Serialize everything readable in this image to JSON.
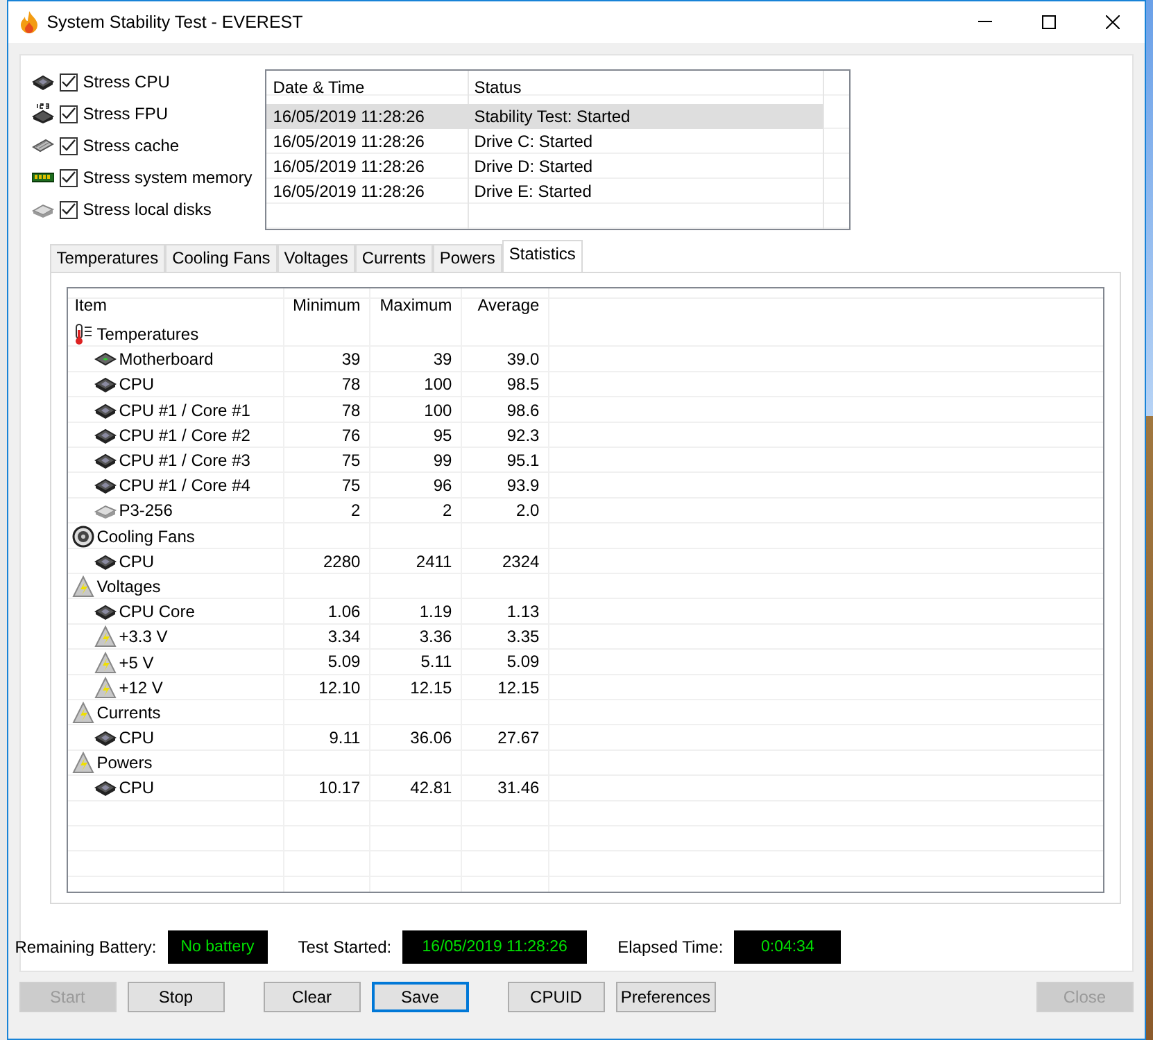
{
  "window": {
    "title": "System Stability Test - EVEREST"
  },
  "stress_options": [
    {
      "label": "Stress CPU",
      "checked": true,
      "kind": "cpu"
    },
    {
      "label": "Stress FPU",
      "checked": true,
      "kind": "fpu"
    },
    {
      "label": "Stress cache",
      "checked": true,
      "kind": "cache"
    },
    {
      "label": "Stress system memory",
      "checked": true,
      "kind": "memory"
    },
    {
      "label": "Stress local disks",
      "checked": true,
      "kind": "disk"
    }
  ],
  "log": {
    "columns": [
      "Date & Time",
      "Status"
    ],
    "rows": [
      {
        "cells": [
          "16/05/2019 11:28:26",
          "Stability Test: Started"
        ],
        "selected": true
      },
      {
        "cells": [
          "16/05/2019 11:28:26",
          "Drive C: Started"
        ],
        "selected": false
      },
      {
        "cells": [
          "16/05/2019 11:28:26",
          "Drive D: Started"
        ],
        "selected": false
      },
      {
        "cells": [
          "16/05/2019 11:28:26",
          "Drive E: Started"
        ],
        "selected": false
      }
    ]
  },
  "tabs": [
    {
      "label": "Temperatures",
      "selected": false
    },
    {
      "label": "Cooling Fans",
      "selected": false
    },
    {
      "label": "Voltages",
      "selected": false
    },
    {
      "label": "Currents",
      "selected": false
    },
    {
      "label": "Powers",
      "selected": false
    },
    {
      "label": "Statistics",
      "selected": true
    }
  ],
  "statistics": {
    "columns": [
      "Item",
      "Minimum",
      "Maximum",
      "Average"
    ],
    "groups": [
      {
        "label": "Temperatures",
        "kind": "thermometer",
        "children": [
          {
            "label": "Motherboard",
            "kind": "board",
            "values": [
              "39",
              "39",
              "39.0"
            ]
          },
          {
            "label": "CPU",
            "kind": "cpu",
            "values": [
              "78",
              "100",
              "98.5"
            ]
          },
          {
            "label": "CPU #1 / Core #1",
            "kind": "cpu",
            "values": [
              "78",
              "100",
              "98.6"
            ]
          },
          {
            "label": "CPU #1 / Core #2",
            "kind": "cpu",
            "values": [
              "76",
              "95",
              "92.3"
            ]
          },
          {
            "label": "CPU #1 / Core #3",
            "kind": "cpu",
            "values": [
              "75",
              "99",
              "95.1"
            ]
          },
          {
            "label": "CPU #1 / Core #4",
            "kind": "cpu",
            "values": [
              "75",
              "96",
              "93.9"
            ]
          },
          {
            "label": "P3-256",
            "kind": "disk",
            "values": [
              "2",
              "2",
              "2.0"
            ]
          }
        ]
      },
      {
        "label": "Cooling Fans",
        "kind": "fan",
        "children": [
          {
            "label": "CPU",
            "kind": "cpu",
            "values": [
              "2280",
              "2411",
              "2324"
            ]
          }
        ]
      },
      {
        "label": "Voltages",
        "kind": "bolt",
        "children": [
          {
            "label": "CPU Core",
            "kind": "cpu",
            "values": [
              "1.06",
              "1.19",
              "1.13"
            ]
          },
          {
            "label": "+3.3 V",
            "kind": "bolt",
            "values": [
              "3.34",
              "3.36",
              "3.35"
            ]
          },
          {
            "label": "+5 V",
            "kind": "bolt",
            "values": [
              "5.09",
              "5.11",
              "5.09"
            ]
          },
          {
            "label": "+12 V",
            "kind": "bolt",
            "values": [
              "12.10",
              "12.15",
              "12.15"
            ]
          }
        ]
      },
      {
        "label": "Currents",
        "kind": "bolt",
        "children": [
          {
            "label": "CPU",
            "kind": "cpu",
            "values": [
              "9.11",
              "36.06",
              "27.67"
            ]
          }
        ]
      },
      {
        "label": "Powers",
        "kind": "bolt",
        "children": [
          {
            "label": "CPU",
            "kind": "cpu",
            "values": [
              "10.17",
              "42.81",
              "31.46"
            ]
          }
        ]
      }
    ]
  },
  "status": [
    {
      "label": "Remaining Battery:",
      "value": "No battery"
    },
    {
      "label": "Test Started:",
      "value": "16/05/2019 11:28:26"
    },
    {
      "label": "Elapsed Time:",
      "value": "0:04:34"
    }
  ],
  "buttons": [
    {
      "label": "Start",
      "disabled": true,
      "focused": false
    },
    {
      "label": "Stop",
      "disabled": false,
      "focused": false
    },
    {
      "label": "Clear",
      "disabled": false,
      "focused": false
    },
    {
      "label": "Save",
      "disabled": false,
      "focused": true
    },
    {
      "label": "CPUID",
      "disabled": false,
      "focused": false
    },
    {
      "label": "Preferences",
      "disabled": false,
      "focused": false
    },
    {
      "label": "Close",
      "disabled": true,
      "focused": false
    }
  ]
}
